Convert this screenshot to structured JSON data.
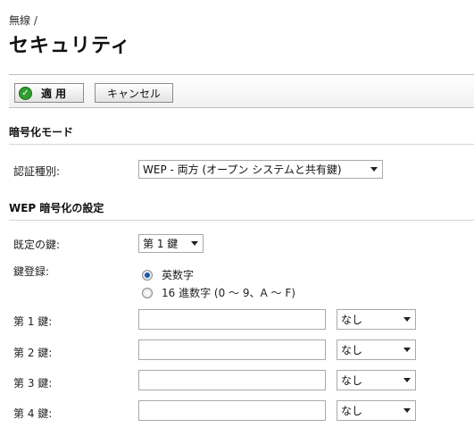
{
  "breadcrumb": "無線 /",
  "page_title": "セキュリティ",
  "toolbar": {
    "apply_label": "適 用",
    "cancel_label": "キャンセル"
  },
  "encryption_mode": {
    "section_title": "暗号化モード",
    "auth_type_label": "認証種別:",
    "auth_type_value": "WEP - 両方 (オープン システムと共有鍵)"
  },
  "wep": {
    "section_title": "WEP 暗号化の設定",
    "default_key_label": "既定の鍵:",
    "default_key_value": "第 1 鍵",
    "key_entry_label": "鍵登録:",
    "radio_options": [
      {
        "label": "英数字",
        "selected": true
      },
      {
        "label": "16 進数字 (0 ～ 9、A ～ F)",
        "selected": false
      }
    ],
    "keys": [
      {
        "label": "第 1 鍵:",
        "value": "",
        "size": "なし"
      },
      {
        "label": "第 2 鍵:",
        "value": "",
        "size": "なし"
      },
      {
        "label": "第 3 鍵:",
        "value": "",
        "size": "なし"
      },
      {
        "label": "第 4 鍵:",
        "value": "",
        "size": "なし"
      }
    ]
  },
  "icons": {
    "apply": "check-circle-icon",
    "dropdown": "chevron-down-icon"
  },
  "colors": {
    "apply_icon": "#2e9e2e",
    "radio_selected": "#1b57b0"
  }
}
